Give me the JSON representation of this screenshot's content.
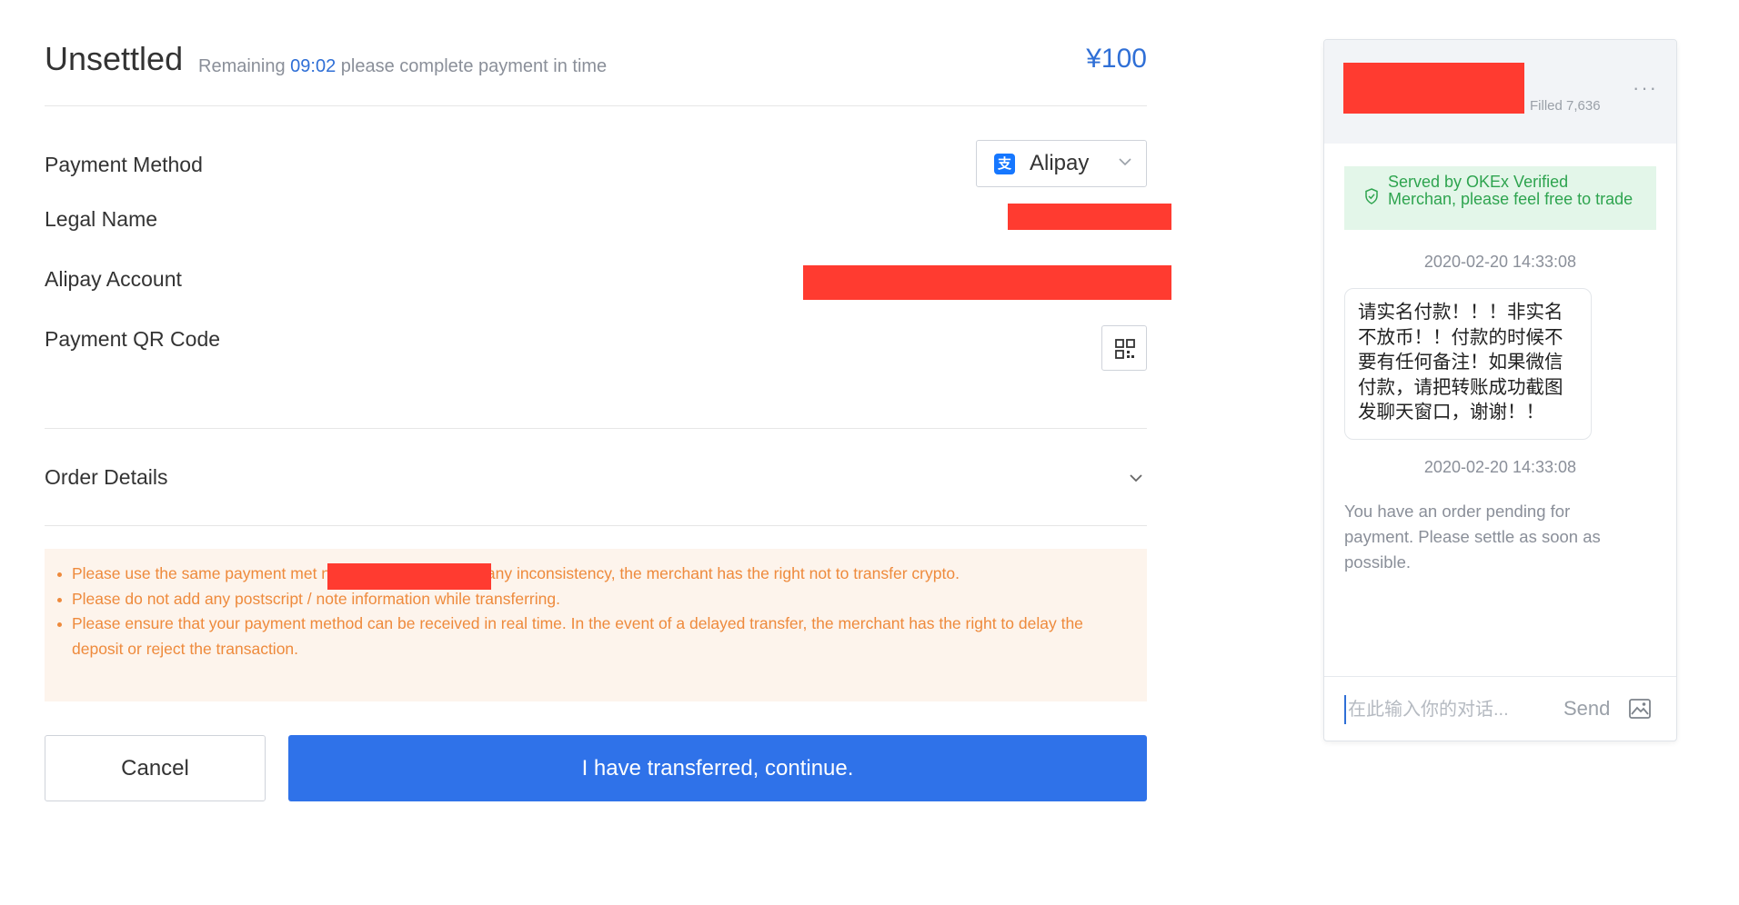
{
  "header": {
    "status": "Unsettled",
    "remaining_label": "Remaining",
    "timer": "09:02",
    "remaining_suffix": "please complete payment in time",
    "amount": "¥100"
  },
  "payment": {
    "method_label": "Payment Method",
    "method_value": "Alipay",
    "legal_name_label": "Legal Name",
    "account_label": "Alipay Account",
    "qr_label": "Payment QR Code"
  },
  "order_details": {
    "label": "Order Details"
  },
  "notice": {
    "items": [
      "Please use the same payment met                    nsfer money. If there is any inconsistency, the merchant has the right not to transfer crypto.",
      "Please do not add any postscript / note information while transferring.",
      "Please ensure that your payment method can be received in real time. In the event of a delayed transfer, the merchant has the right to delay the deposit or reject the transaction."
    ]
  },
  "actions": {
    "cancel": "Cancel",
    "continue": "I have transferred, continue."
  },
  "chat": {
    "filled": "Filled 7,636",
    "more": "···",
    "verified": "Served by OKEx Verified Merchan, please feel free to trade",
    "timestamp_1": "2020-02-20 14:33:08",
    "message": "请实名付款！！！非实名不放币！！付款的时候不要有任何备注！如果微信付款，请把转账成功截图发聊天窗口，谢谢！！",
    "timestamp_2": "2020-02-20 14:33:08",
    "system_message": "You have an order pending for payment. Please settle as soon as possible.",
    "input_placeholder": "在此输入你的对话...",
    "send": "Send"
  },
  "colors": {
    "accent": "#2f72e9",
    "warning_text": "#ee8a3c",
    "warning_bg": "#fdf4ec",
    "verified_text": "#2ea44f",
    "verified_bg": "#e3f6e9",
    "redaction": "#ff3b30"
  },
  "icons": [
    "alipay-logo-icon",
    "chevron-down-icon",
    "qr-code-icon",
    "shield-check-icon",
    "more-icon",
    "image-icon"
  ]
}
